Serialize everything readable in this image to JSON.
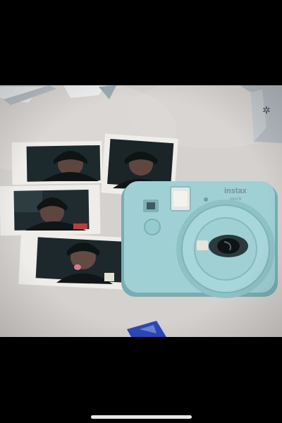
{
  "photo": {
    "subject": "polaroid-photos-and-instant-camera",
    "camera": {
      "brand": "instax",
      "model": "mini 9",
      "color": "#9fd0d4"
    },
    "instant_prints_count": 4
  },
  "colors": {
    "background": "#000000",
    "tabletop": "#d3d0cd",
    "camera_body": "#9fd0d4",
    "camera_shadow": "#78aeb3",
    "print_border": "#eeedea",
    "print_image": "#1a2528"
  }
}
